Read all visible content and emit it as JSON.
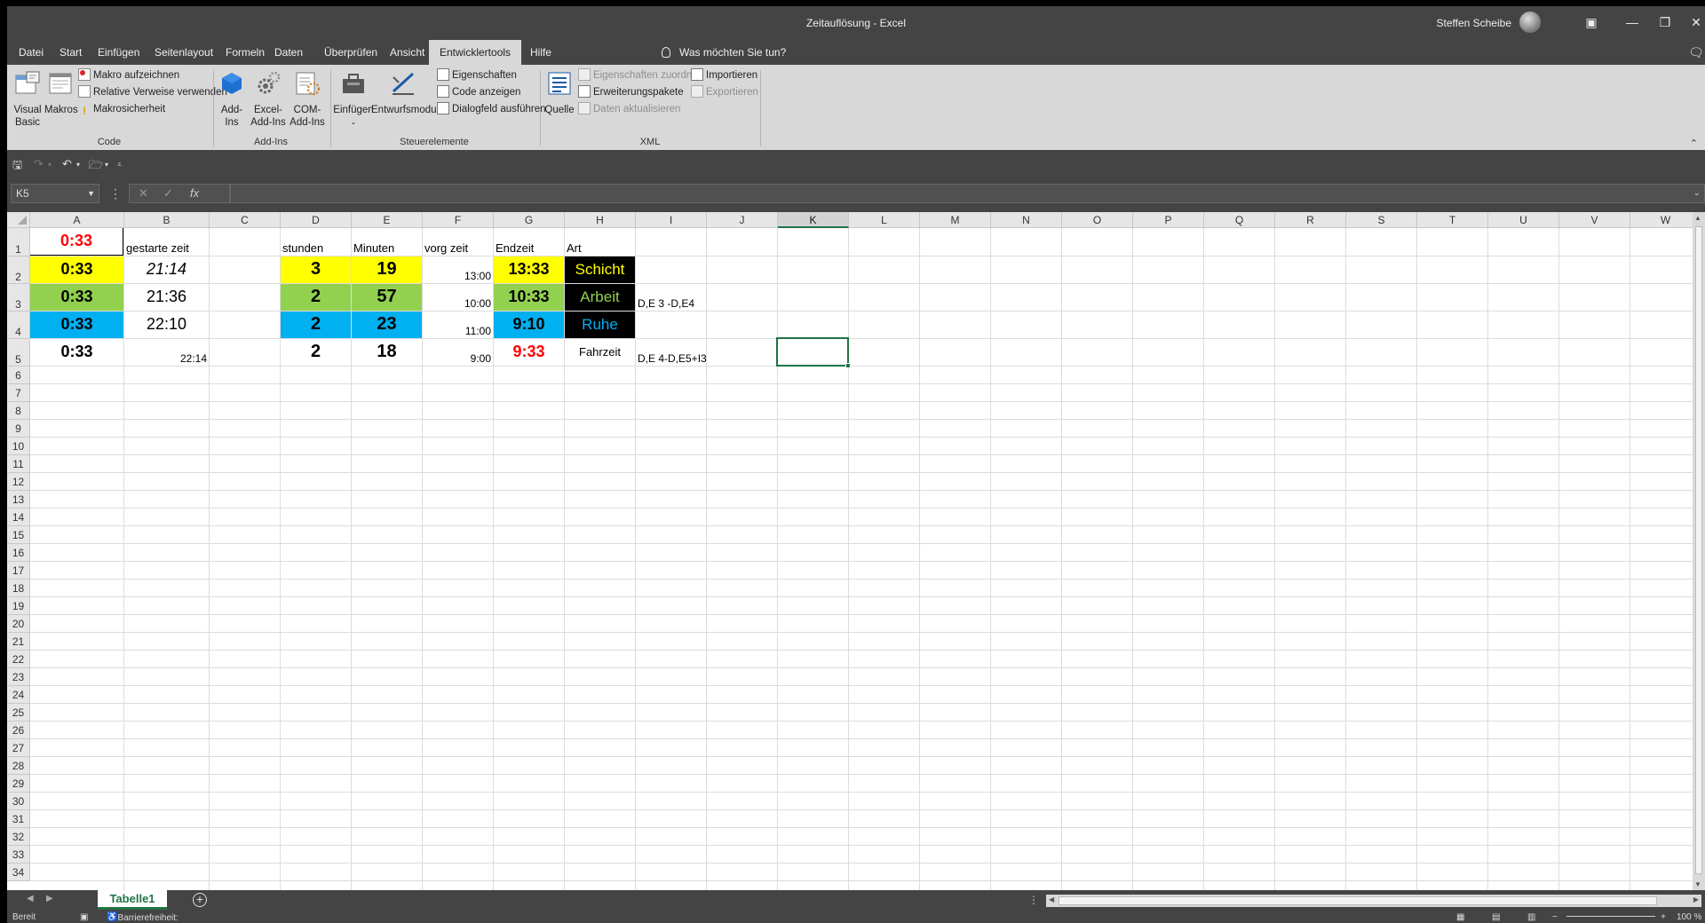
{
  "window": {
    "title": "Zeitauflösung  -  Excel",
    "user": "Steffen Scheibe"
  },
  "tabs": [
    "Datei",
    "Start",
    "Einfügen",
    "Seitenlayout",
    "Formeln",
    "Daten",
    "Überprüfen",
    "Ansicht",
    "Entwicklertools",
    "Hilfe"
  ],
  "active_tab": "Entwicklertools",
  "tell_me": "Was möchten Sie tun?",
  "ribbon": {
    "code": {
      "label": "Code",
      "visual_basic": [
        "Visual",
        "Basic"
      ],
      "makros": "Makros",
      "record_macro": "Makro aufzeichnen",
      "relative_refs": "Relative Verweise verwenden",
      "macro_security": "Makrosicherheit"
    },
    "addins": {
      "label": "Add-Ins",
      "addins": [
        "Add-",
        "Ins"
      ],
      "excel_addins": [
        "Excel-",
        "Add-Ins"
      ],
      "com_addins": [
        "COM-",
        "Add-Ins"
      ]
    },
    "controls": {
      "label": "Steuerelemente",
      "insert": "Einfügen",
      "design_mode": "Entwurfsmodus",
      "properties": "Eigenschaften",
      "view_code": "Code anzeigen",
      "run_dialog": "Dialogfeld ausführen"
    },
    "xml": {
      "label": "XML",
      "source": "Quelle",
      "map_properties": "Eigenschaften zuordnen",
      "expansion_packs": "Erweiterungspakete",
      "refresh_data": "Daten aktualisieren",
      "import": "Importieren",
      "export": "Exportieren"
    }
  },
  "name_box": "K5",
  "formula": "",
  "columns": [
    "A",
    "B",
    "C",
    "D",
    "E",
    "F",
    "G",
    "H",
    "I",
    "J",
    "K",
    "L",
    "M",
    "N",
    "O",
    "P",
    "Q",
    "R",
    "S",
    "T",
    "U",
    "V",
    "W"
  ],
  "selected_column": "K",
  "rows": [
    "1",
    "2",
    "3",
    "4",
    "5",
    "6",
    "7",
    "8",
    "9",
    "10",
    "11",
    "12",
    "13",
    "14",
    "15",
    "16",
    "17",
    "18",
    "19",
    "20",
    "21",
    "22",
    "23",
    "24",
    "25",
    "26",
    "27",
    "28",
    "29",
    "30",
    "31",
    "32",
    "33",
    "34"
  ],
  "cells": {
    "A1": "0:33",
    "B1": "gestarte zeit",
    "D1": "stunden",
    "E1": "Minuten",
    "F1": "vorg zeit",
    "G1": "Endzeit",
    "H1": "Art",
    "A2": "0:33",
    "B2": "21:14",
    "D2": "3",
    "E2": "19",
    "F2": "13:00",
    "G2": "13:33",
    "H2": "Schicht",
    "A3": "0:33",
    "B3": "21:36",
    "D3": "2",
    "E3": "57",
    "F3": "10:00",
    "G3": "10:33",
    "H3": "Arbeit",
    "I3": "D,E 3 -D,E4",
    "A4": "0:33",
    "B4": "22:10",
    "D4": "2",
    "E4": "23",
    "F4": "11:00",
    "G4": "9:10",
    "H4": "Ruhe",
    "A5": "0:33",
    "B5": "22:14",
    "D5": "2",
    "E5": "18",
    "F5": "9:00",
    "G5": "9:33",
    "H5": "Fahrzeit",
    "I5": "D,E 4-D,E5+I3"
  },
  "colors": {
    "yellow": "#ffff00",
    "green": "#92d050",
    "blue": "#00b0f0",
    "red": "#ff0000",
    "black": "#000000",
    "excel_green": "#217346"
  },
  "sheet_tab": "Tabelle1",
  "status": {
    "ready": "Bereit",
    "accessibility": "Barrierefreiheit: Keine Probleme",
    "zoom": "100 %"
  }
}
